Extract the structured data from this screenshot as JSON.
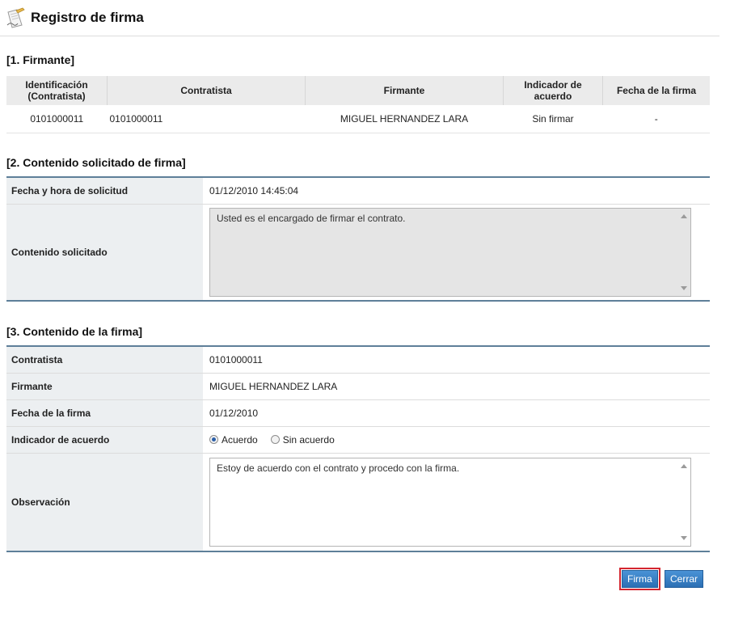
{
  "header": {
    "title": "Registro de firma",
    "icon": "document-sign-icon"
  },
  "section1": {
    "title": "[1. Firmante]",
    "columns": [
      "Identificación (Contratista)",
      "Contratista",
      "Firmante",
      "Indicador de acuerdo",
      "Fecha de la firma"
    ],
    "rows": [
      [
        "0101000011",
        "0101000011",
        "MIGUEL HERNANDEZ LARA",
        "Sin firmar",
        "-"
      ]
    ]
  },
  "section2": {
    "title": "[2. Contenido solicitado de firma]",
    "fecha_label": "Fecha y hora de solicitud",
    "fecha_value": "01/12/2010 14:45:04",
    "contenido_label": "Contenido solicitado",
    "contenido_value": "Usted es el encargado de firmar el contrato."
  },
  "section3": {
    "title": "[3. Contenido de la firma]",
    "contratista_label": "Contratista",
    "contratista_value": "0101000011",
    "firmante_label": "Firmante",
    "firmante_value": "MIGUEL HERNANDEZ LARA",
    "fecha_label": "Fecha de la firma",
    "fecha_value": "01/12/2010",
    "indicador_label": "Indicador de acuerdo",
    "option_acuerdo": "Acuerdo",
    "option_sin_acuerdo": "Sin acuerdo",
    "selected": "Acuerdo",
    "observacion_label": "Observación",
    "observacion_value": "Estoy de acuerdo con el contrato y procedo con la firma."
  },
  "buttons": {
    "firma": "Firma",
    "cerrar": "Cerrar"
  },
  "colors": {
    "accent": "#2b6fb4",
    "highlight": "#d4262f",
    "rule": "#5e7f99"
  }
}
